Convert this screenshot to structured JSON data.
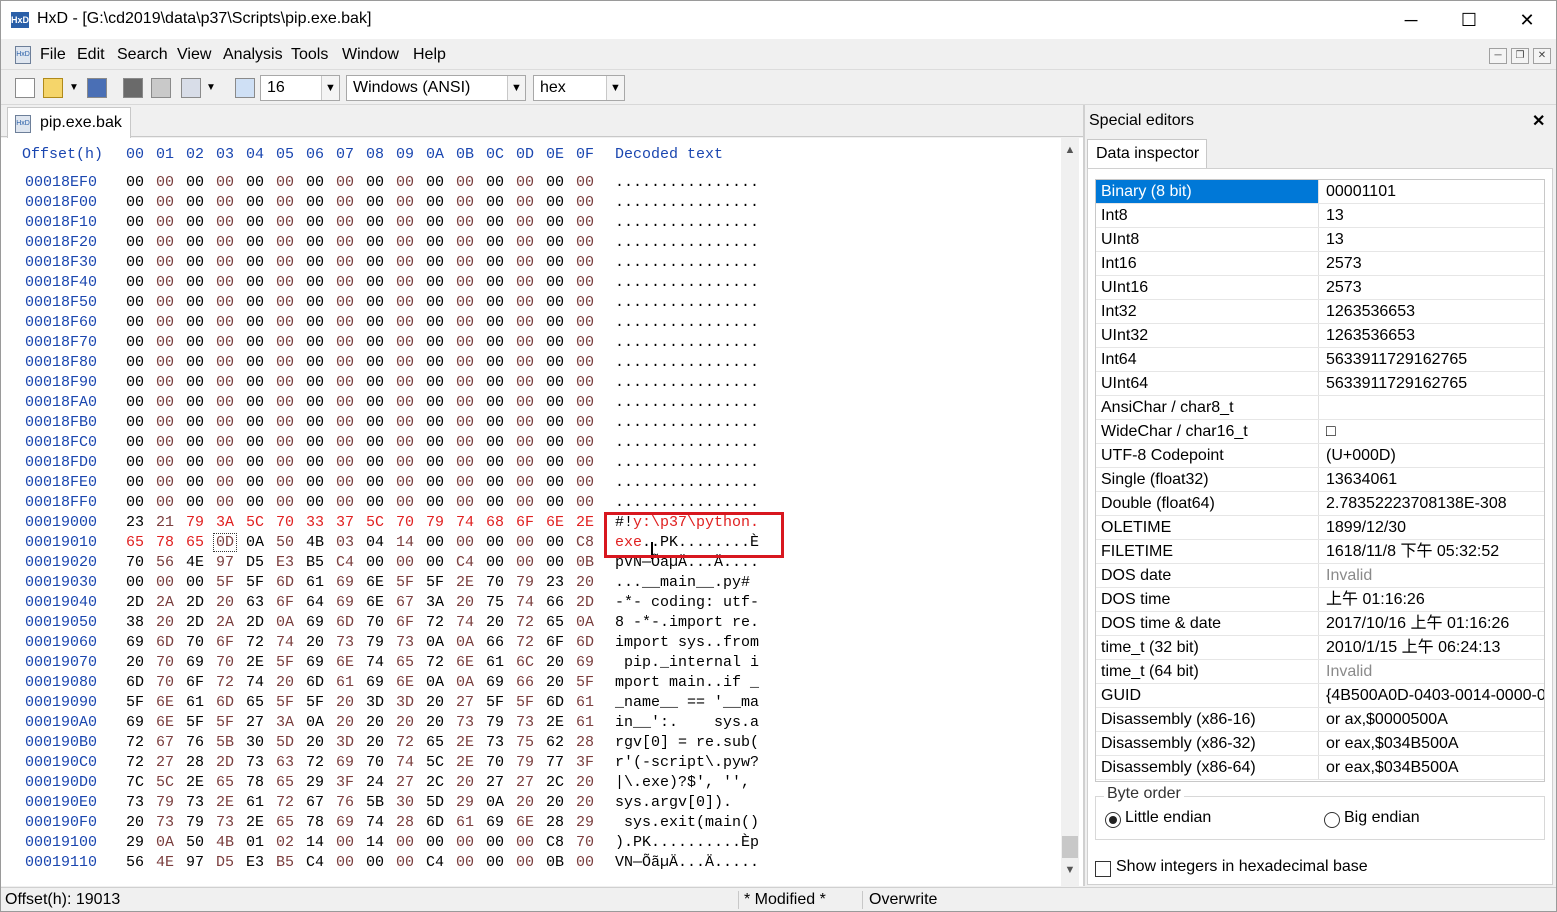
{
  "window": {
    "title": "HxD - [G:\\cd2019\\data\\p37\\Scripts\\pip.exe.bak]",
    "app_icon": "HxD",
    "minimize": "─",
    "maximize": "☐",
    "close": "✕"
  },
  "menu": {
    "icon": "HxD",
    "items": [
      "File",
      "Edit",
      "Search",
      "View",
      "Analysis",
      "Tools",
      "Window",
      "Help"
    ],
    "mdi_minimize": "─",
    "mdi_restore": "❐",
    "mdi_close": "✕"
  },
  "toolbar": {
    "bytes_per_row": "16",
    "charset": "Windows (ANSI)",
    "display_base": "hex",
    "dropdown_arrow": "▼"
  },
  "document_tab": {
    "label": "pip.exe.bak",
    "icon": "HxD"
  },
  "hex_view": {
    "offset_header": "Offset(h)",
    "column_headers": [
      "00",
      "01",
      "02",
      "03",
      "04",
      "05",
      "06",
      "07",
      "08",
      "09",
      "0A",
      "0B",
      "0C",
      "0D",
      "0E",
      "0F"
    ],
    "decoded_header": "Decoded text",
    "scroll_up": "▲",
    "scroll_down": "▼",
    "rows": [
      {
        "offset": "00018EF0",
        "bytes": [
          "00",
          "00",
          "00",
          "00",
          "00",
          "00",
          "00",
          "00",
          "00",
          "00",
          "00",
          "00",
          "00",
          "00",
          "00",
          "00"
        ],
        "text": "................"
      },
      {
        "offset": "00018F00",
        "bytes": [
          "00",
          "00",
          "00",
          "00",
          "00",
          "00",
          "00",
          "00",
          "00",
          "00",
          "00",
          "00",
          "00",
          "00",
          "00",
          "00"
        ],
        "text": "................"
      },
      {
        "offset": "00018F10",
        "bytes": [
          "00",
          "00",
          "00",
          "00",
          "00",
          "00",
          "00",
          "00",
          "00",
          "00",
          "00",
          "00",
          "00",
          "00",
          "00",
          "00"
        ],
        "text": "................"
      },
      {
        "offset": "00018F20",
        "bytes": [
          "00",
          "00",
          "00",
          "00",
          "00",
          "00",
          "00",
          "00",
          "00",
          "00",
          "00",
          "00",
          "00",
          "00",
          "00",
          "00"
        ],
        "text": "................"
      },
      {
        "offset": "00018F30",
        "bytes": [
          "00",
          "00",
          "00",
          "00",
          "00",
          "00",
          "00",
          "00",
          "00",
          "00",
          "00",
          "00",
          "00",
          "00",
          "00",
          "00"
        ],
        "text": "................"
      },
      {
        "offset": "00018F40",
        "bytes": [
          "00",
          "00",
          "00",
          "00",
          "00",
          "00",
          "00",
          "00",
          "00",
          "00",
          "00",
          "00",
          "00",
          "00",
          "00",
          "00"
        ],
        "text": "................"
      },
      {
        "offset": "00018F50",
        "bytes": [
          "00",
          "00",
          "00",
          "00",
          "00",
          "00",
          "00",
          "00",
          "00",
          "00",
          "00",
          "00",
          "00",
          "00",
          "00",
          "00"
        ],
        "text": "................"
      },
      {
        "offset": "00018F60",
        "bytes": [
          "00",
          "00",
          "00",
          "00",
          "00",
          "00",
          "00",
          "00",
          "00",
          "00",
          "00",
          "00",
          "00",
          "00",
          "00",
          "00"
        ],
        "text": "................"
      },
      {
        "offset": "00018F70",
        "bytes": [
          "00",
          "00",
          "00",
          "00",
          "00",
          "00",
          "00",
          "00",
          "00",
          "00",
          "00",
          "00",
          "00",
          "00",
          "00",
          "00"
        ],
        "text": "................"
      },
      {
        "offset": "00018F80",
        "bytes": [
          "00",
          "00",
          "00",
          "00",
          "00",
          "00",
          "00",
          "00",
          "00",
          "00",
          "00",
          "00",
          "00",
          "00",
          "00",
          "00"
        ],
        "text": "................"
      },
      {
        "offset": "00018F90",
        "bytes": [
          "00",
          "00",
          "00",
          "00",
          "00",
          "00",
          "00",
          "00",
          "00",
          "00",
          "00",
          "00",
          "00",
          "00",
          "00",
          "00"
        ],
        "text": "................"
      },
      {
        "offset": "00018FA0",
        "bytes": [
          "00",
          "00",
          "00",
          "00",
          "00",
          "00",
          "00",
          "00",
          "00",
          "00",
          "00",
          "00",
          "00",
          "00",
          "00",
          "00"
        ],
        "text": "................"
      },
      {
        "offset": "00018FB0",
        "bytes": [
          "00",
          "00",
          "00",
          "00",
          "00",
          "00",
          "00",
          "00",
          "00",
          "00",
          "00",
          "00",
          "00",
          "00",
          "00",
          "00"
        ],
        "text": "................"
      },
      {
        "offset": "00018FC0",
        "bytes": [
          "00",
          "00",
          "00",
          "00",
          "00",
          "00",
          "00",
          "00",
          "00",
          "00",
          "00",
          "00",
          "00",
          "00",
          "00",
          "00"
        ],
        "text": "................"
      },
      {
        "offset": "00018FD0",
        "bytes": [
          "00",
          "00",
          "00",
          "00",
          "00",
          "00",
          "00",
          "00",
          "00",
          "00",
          "00",
          "00",
          "00",
          "00",
          "00",
          "00"
        ],
        "text": "................"
      },
      {
        "offset": "00018FE0",
        "bytes": [
          "00",
          "00",
          "00",
          "00",
          "00",
          "00",
          "00",
          "00",
          "00",
          "00",
          "00",
          "00",
          "00",
          "00",
          "00",
          "00"
        ],
        "text": "................"
      },
      {
        "offset": "00018FF0",
        "bytes": [
          "00",
          "00",
          "00",
          "00",
          "00",
          "00",
          "00",
          "00",
          "00",
          "00",
          "00",
          "00",
          "00",
          "00",
          "00",
          "00"
        ],
        "text": "................"
      },
      {
        "offset": "00019000",
        "bytes": [
          "23",
          "21",
          "79",
          "3A",
          "5C",
          "70",
          "33",
          "37",
          "5C",
          "70",
          "79",
          "74",
          "68",
          "6F",
          "6E",
          "2E"
        ],
        "text": "#!y:\\p37\\python.",
        "mod_from": 2,
        "text_mod_from": 2
      },
      {
        "offset": "00019010",
        "bytes": [
          "65",
          "78",
          "65",
          "0D",
          "0A",
          "50",
          "4B",
          "03",
          "04",
          "14",
          "00",
          "00",
          "00",
          "00",
          "00",
          "C8"
        ],
        "text": "exe..PK........È",
        "mod_to": 3,
        "text_mod_to": 3
      },
      {
        "offset": "00019020",
        "bytes": [
          "70",
          "56",
          "4E",
          "97",
          "D5",
          "E3",
          "B5",
          "C4",
          "00",
          "00",
          "00",
          "C4",
          "00",
          "00",
          "00",
          "0B"
        ],
        "text": "pVN—ÕãµÄ...Ä...."
      },
      {
        "offset": "00019030",
        "bytes": [
          "00",
          "00",
          "00",
          "5F",
          "5F",
          "6D",
          "61",
          "69",
          "6E",
          "5F",
          "5F",
          "2E",
          "70",
          "79",
          "23",
          "20"
        ],
        "text": "...__main__.py# "
      },
      {
        "offset": "00019040",
        "bytes": [
          "2D",
          "2A",
          "2D",
          "20",
          "63",
          "6F",
          "64",
          "69",
          "6E",
          "67",
          "3A",
          "20",
          "75",
          "74",
          "66",
          "2D"
        ],
        "text": "-*- coding: utf-"
      },
      {
        "offset": "00019050",
        "bytes": [
          "38",
          "20",
          "2D",
          "2A",
          "2D",
          "0A",
          "69",
          "6D",
          "70",
          "6F",
          "72",
          "74",
          "20",
          "72",
          "65",
          "0A"
        ],
        "text": "8 -*-.import re."
      },
      {
        "offset": "00019060",
        "bytes": [
          "69",
          "6D",
          "70",
          "6F",
          "72",
          "74",
          "20",
          "73",
          "79",
          "73",
          "0A",
          "0A",
          "66",
          "72",
          "6F",
          "6D"
        ],
        "text": "import sys..from"
      },
      {
        "offset": "00019070",
        "bytes": [
          "20",
          "70",
          "69",
          "70",
          "2E",
          "5F",
          "69",
          "6E",
          "74",
          "65",
          "72",
          "6E",
          "61",
          "6C",
          "20",
          "69"
        ],
        "text": " pip._internal i"
      },
      {
        "offset": "00019080",
        "bytes": [
          "6D",
          "70",
          "6F",
          "72",
          "74",
          "20",
          "6D",
          "61",
          "69",
          "6E",
          "0A",
          "0A",
          "69",
          "66",
          "20",
          "5F"
        ],
        "text": "mport main..if _"
      },
      {
        "offset": "00019090",
        "bytes": [
          "5F",
          "6E",
          "61",
          "6D",
          "65",
          "5F",
          "5F",
          "20",
          "3D",
          "3D",
          "20",
          "27",
          "5F",
          "5F",
          "6D",
          "61"
        ],
        "text": "_name__ == '__ma"
      },
      {
        "offset": "000190A0",
        "bytes": [
          "69",
          "6E",
          "5F",
          "5F",
          "27",
          "3A",
          "0A",
          "20",
          "20",
          "20",
          "20",
          "73",
          "79",
          "73",
          "2E",
          "61"
        ],
        "text": "in__':.    sys.a"
      },
      {
        "offset": "000190B0",
        "bytes": [
          "72",
          "67",
          "76",
          "5B",
          "30",
          "5D",
          "20",
          "3D",
          "20",
          "72",
          "65",
          "2E",
          "73",
          "75",
          "62",
          "28"
        ],
        "text": "rgv[0] = re.sub("
      },
      {
        "offset": "000190C0",
        "bytes": [
          "72",
          "27",
          "28",
          "2D",
          "73",
          "63",
          "72",
          "69",
          "70",
          "74",
          "5C",
          "2E",
          "70",
          "79",
          "77",
          "3F"
        ],
        "text": "r'(-script\\.pyw?"
      },
      {
        "offset": "000190D0",
        "bytes": [
          "7C",
          "5C",
          "2E",
          "65",
          "78",
          "65",
          "29",
          "3F",
          "24",
          "27",
          "2C",
          "20",
          "27",
          "27",
          "2C",
          "20"
        ],
        "text": "|\\.exe)?$', '', "
      },
      {
        "offset": "000190E0",
        "bytes": [
          "73",
          "79",
          "73",
          "2E",
          "61",
          "72",
          "67",
          "76",
          "5B",
          "30",
          "5D",
          "29",
          "0A",
          "20",
          "20",
          "20"
        ],
        "text": "sys.argv[0]).   "
      },
      {
        "offset": "000190F0",
        "bytes": [
          "20",
          "73",
          "79",
          "73",
          "2E",
          "65",
          "78",
          "69",
          "74",
          "28",
          "6D",
          "61",
          "69",
          "6E",
          "28",
          "29"
        ],
        "text": " sys.exit(main()"
      },
      {
        "offset": "00019100",
        "bytes": [
          "29",
          "0A",
          "50",
          "4B",
          "01",
          "02",
          "14",
          "00",
          "14",
          "00",
          "00",
          "00",
          "00",
          "00",
          "C8",
          "70"
        ],
        "text": ").PK..........Èp"
      },
      {
        "offset": "00019110",
        "bytes": [
          "56",
          "4E",
          "97",
          "D5",
          "E3",
          "B5",
          "C4",
          "00",
          "00",
          "00",
          "C4",
          "00",
          "00",
          "00",
          "0B",
          "00"
        ],
        "text": "VN—ÕãµÄ...Ä....."
      }
    ]
  },
  "special_editors": {
    "title": "Special editors",
    "close": "✕",
    "tab": "Data inspector",
    "rows": [
      {
        "label": "Binary (8 bit)",
        "value": "00001101",
        "selected": true
      },
      {
        "label": "Int8",
        "value": "13"
      },
      {
        "label": "UInt8",
        "value": "13"
      },
      {
        "label": "Int16",
        "value": "2573"
      },
      {
        "label": "UInt16",
        "value": "2573"
      },
      {
        "label": "Int32",
        "value": "1263536653"
      },
      {
        "label": "UInt32",
        "value": "1263536653"
      },
      {
        "label": "Int64",
        "value": "5633911729162765"
      },
      {
        "label": "UInt64",
        "value": "5633911729162765"
      },
      {
        "label": "AnsiChar / char8_t",
        "value": ""
      },
      {
        "label": "WideChar / char16_t",
        "value": "□"
      },
      {
        "label": "UTF-8 Codepoint",
        "value": " (U+000D)"
      },
      {
        "label": "Single (float32)",
        "value": "13634061"
      },
      {
        "label": "Double (float64)",
        "value": "2.78352223708138E-308"
      },
      {
        "label": "OLETIME",
        "value": "1899/12/30"
      },
      {
        "label": "FILETIME",
        "value": "1618/11/8 下午 05:32:52"
      },
      {
        "label": "DOS date",
        "value": "Invalid",
        "invalid": true
      },
      {
        "label": "DOS time",
        "value": "上午 01:16:26"
      },
      {
        "label": "DOS time & date",
        "value": "2017/10/16 上午 01:16:26"
      },
      {
        "label": "time_t (32 bit)",
        "value": "2010/1/15 上午 06:24:13"
      },
      {
        "label": "time_t (64 bit)",
        "value": "Invalid",
        "invalid": true
      },
      {
        "label": "GUID",
        "value": "{4B500A0D-0403-0014-0000-0"
      },
      {
        "label": "Disassembly (x86-16)",
        "value": "or ax,$0000500A"
      },
      {
        "label": "Disassembly (x86-32)",
        "value": "or eax,$034B500A"
      },
      {
        "label": "Disassembly (x86-64)",
        "value": "or eax,$034B500A"
      }
    ],
    "byte_order": {
      "legend": "Byte order",
      "little": "Little endian",
      "big": "Big endian",
      "selected": "little"
    },
    "hex_checkbox": "Show integers in hexadecimal base"
  },
  "status": {
    "offset": "Offset(h): 19013",
    "modified": "* Modified *",
    "mode": "Overwrite"
  },
  "colors": {
    "offset_blue": "#1a46b0",
    "modified_red": "#e02020",
    "selection": "#0078d7",
    "annotation_box": "#d8171f"
  }
}
